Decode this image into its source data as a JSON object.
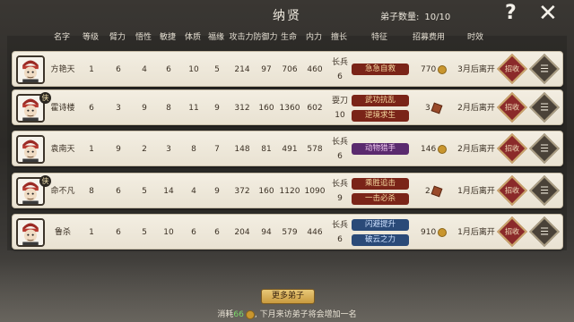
{
  "topbar": {
    "title": "纳贤",
    "count_label": "弟子数量:",
    "count_value": "10/10",
    "help": "?",
    "close": "✕"
  },
  "columns": [
    "名字",
    "等级",
    "臂力",
    "悟性",
    "敏捷",
    "体质",
    "福缘",
    "攻击力",
    "防御力",
    "生命",
    "内力",
    "擅长",
    "特征",
    "招募费用",
    "时效"
  ],
  "rows": [
    {
      "name": "方艳天",
      "level": "1",
      "str": "6",
      "int": "4",
      "agi": "6",
      "con": "10",
      "luck": "5",
      "atk": "214",
      "def": "97",
      "hp": "706",
      "mp": "460",
      "weapon": "长兵",
      "weapon_lv": "6",
      "badge": "",
      "traits": [
        {
          "text": "急急自救",
          "color": "red"
        }
      ],
      "fee": "770",
      "fee_icon": "coin",
      "time": "3月后离开",
      "recruit": "招收"
    },
    {
      "name": "霍诗楼",
      "level": "6",
      "str": "3",
      "int": "9",
      "agi": "8",
      "con": "11",
      "luck": "9",
      "atk": "312",
      "def": "160",
      "hp": "1360",
      "mp": "602",
      "weapon": "耍刀",
      "weapon_lv": "10",
      "badge": "侠",
      "traits": [
        {
          "text": "武功抗乱",
          "color": "red"
        },
        {
          "text": "逆境求生",
          "color": "red"
        }
      ],
      "fee": "3",
      "fee_icon": "ticket",
      "time": "2月后离开",
      "recruit": "招收"
    },
    {
      "name": "袁南天",
      "level": "1",
      "str": "9",
      "int": "2",
      "agi": "3",
      "con": "8",
      "luck": "7",
      "atk": "148",
      "def": "81",
      "hp": "491",
      "mp": "578",
      "weapon": "长兵",
      "weapon_lv": "6",
      "badge": "",
      "traits": [
        {
          "text": "动物猎手",
          "color": "purple"
        }
      ],
      "fee": "146",
      "fee_icon": "coin",
      "time": "2月后离开",
      "recruit": "招收"
    },
    {
      "name": "命不凡",
      "level": "8",
      "str": "6",
      "int": "5",
      "agi": "14",
      "con": "4",
      "luck": "9",
      "atk": "372",
      "def": "160",
      "hp": "1120",
      "mp": "1090",
      "weapon": "长兵",
      "weapon_lv": "9",
      "badge": "侠",
      "traits": [
        {
          "text": "乘胜追击",
          "color": "red"
        },
        {
          "text": "一击必杀",
          "color": "red"
        }
      ],
      "fee": "2",
      "fee_icon": "ticket",
      "time": "1月后离开",
      "recruit": "招收"
    },
    {
      "name": "鲁杀",
      "level": "1",
      "str": "6",
      "int": "5",
      "agi": "10",
      "con": "6",
      "luck": "6",
      "atk": "204",
      "def": "94",
      "hp": "579",
      "mp": "446",
      "weapon": "长兵",
      "weapon_lv": "6",
      "badge": "",
      "traits": [
        {
          "text": "闪避提升",
          "color": "blue"
        },
        {
          "text": "破云之力",
          "color": "blue"
        }
      ],
      "fee": "910",
      "fee_icon": "coin",
      "time": "1月后离开",
      "recruit": "招收"
    }
  ],
  "more_button": "更多弟子",
  "footer": {
    "prefix": "消耗",
    "amount": "66",
    "suffix": ", 下月来访弟子将会增加一名"
  },
  "menu_glyph": "☰"
}
